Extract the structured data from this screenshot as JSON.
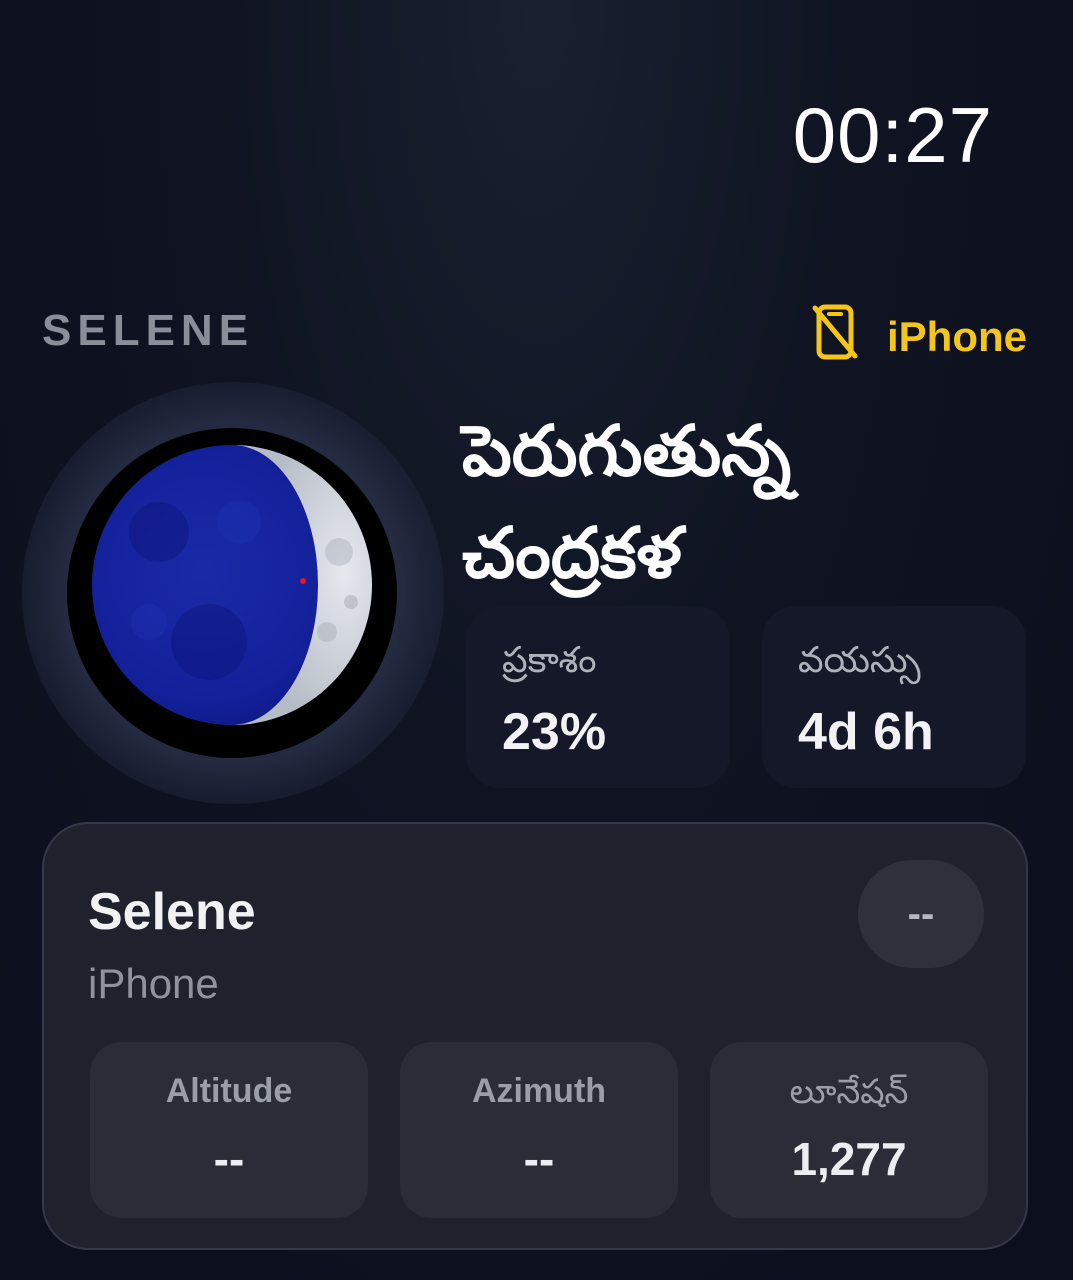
{
  "status": {
    "time": "00:27"
  },
  "header": {
    "brand": "SELENE",
    "device_label": "iPhone",
    "device_icon": "phone-off-icon",
    "accent_color": "#f4c51a"
  },
  "moon": {
    "phase_name": "పెరుగుతున్న చంద్రకళ",
    "illumination_fraction": 0.23,
    "stats": [
      {
        "label": "ప్రకాశం",
        "value": "23%"
      },
      {
        "label": "వయస్సు",
        "value": "4d 6h"
      }
    ]
  },
  "card": {
    "title": "Selene",
    "subtitle": "iPhone",
    "badge": "--",
    "metrics": [
      {
        "label": "Altitude",
        "value": "--"
      },
      {
        "label": "Azimuth",
        "value": "--"
      },
      {
        "label": "లూనేషన్",
        "value": "1,277"
      }
    ]
  }
}
